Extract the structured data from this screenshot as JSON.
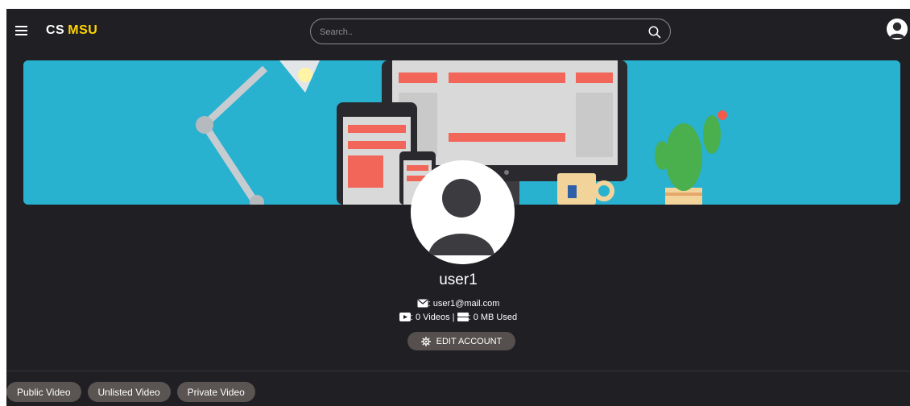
{
  "header": {
    "brand_cs": "CS",
    "brand_msu": "MSU",
    "search_placeholder": "Search.."
  },
  "profile": {
    "username": "user1",
    "email": ": user1@mail.com",
    "videos": ": 0 Videos |",
    "storage": ": 0 MB Used",
    "edit_label": "EDIT ACCOUNT"
  },
  "tabs": [
    {
      "label": "Public Video"
    },
    {
      "label": "Unlisted Video"
    },
    {
      "label": "Private Video"
    }
  ],
  "colors": {
    "background": "#1f1f24",
    "brand_accent": "#ffd400",
    "banner": "#29b1d0",
    "pill": "#5a5452"
  },
  "icons": [
    "menu-icon",
    "search-icon",
    "user-avatar-icon",
    "mail-icon",
    "video-icon",
    "storage-icon",
    "gear-icon"
  ]
}
